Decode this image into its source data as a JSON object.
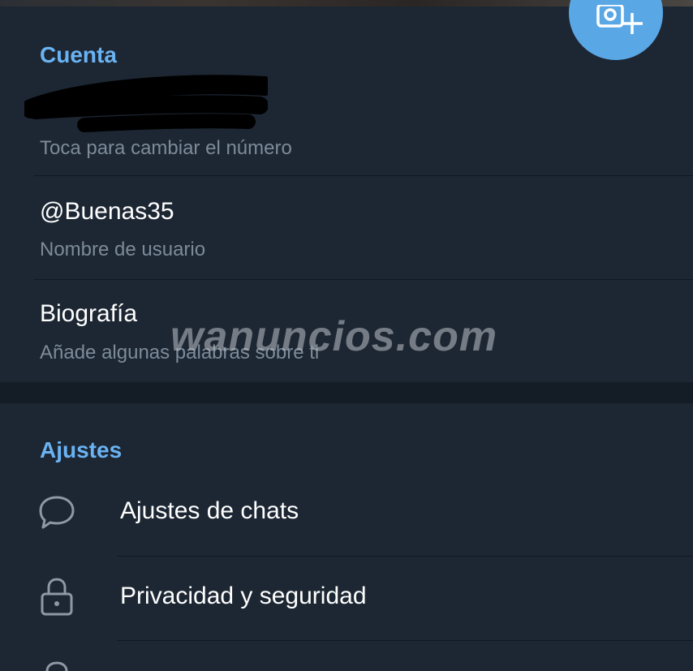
{
  "account": {
    "header": "Cuenta",
    "phone_hint": "Toca para cambiar el número",
    "username": "@Buenas35",
    "username_hint": "Nombre de usuario",
    "bio_label": "Biografía",
    "bio_hint": "Añade algunas palabras sobre ti"
  },
  "settings": {
    "header": "Ajustes",
    "items": [
      {
        "label": "Ajustes de chats",
        "icon": "chat-bubble-icon"
      },
      {
        "label": "Privacidad y seguridad",
        "icon": "lock-icon"
      }
    ]
  },
  "watermark": "wanuncios.com",
  "colors": {
    "background": "#1d2733",
    "accent": "#6ab3f3",
    "fab": "#5aa7e6",
    "secondary_text": "#7d8b99"
  }
}
